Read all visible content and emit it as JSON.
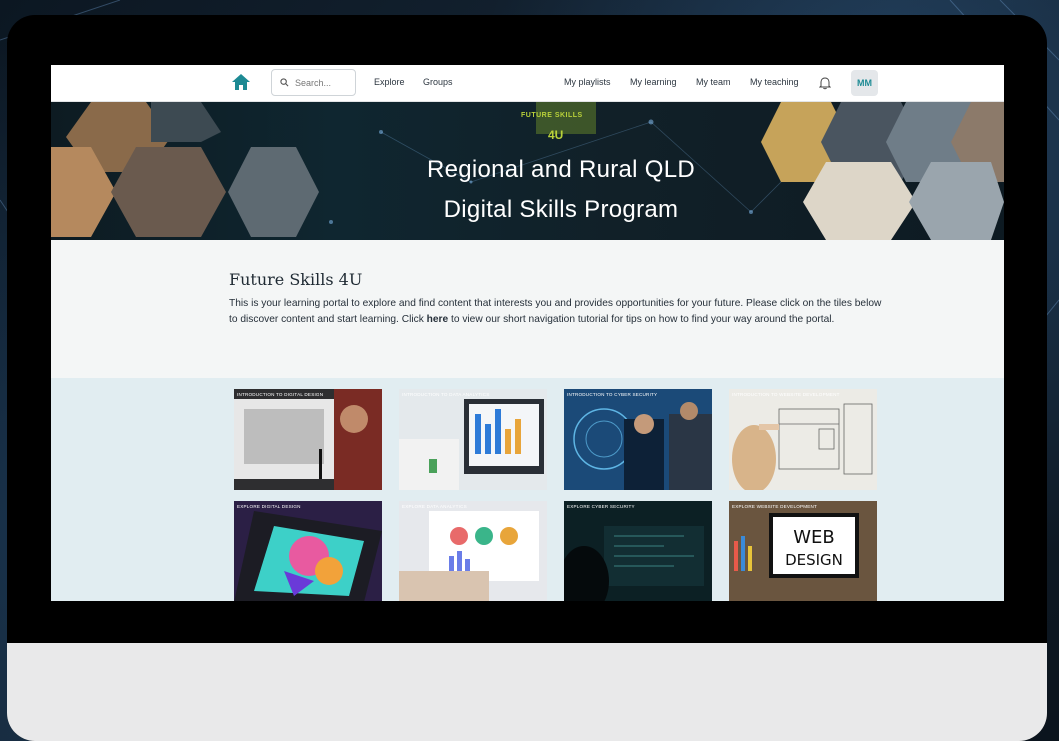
{
  "nav": {
    "search_placeholder": "Search...",
    "links_left": [
      "Explore",
      "Groups"
    ],
    "links_right": [
      "My playlists",
      "My learning",
      "My team",
      "My teaching"
    ],
    "avatar_initials": "MM",
    "accent": "#1d8a94"
  },
  "banner": {
    "title_line1": "Regional and Rural QLD",
    "title_line2": "Digital Skills Program",
    "logo_text": "FUTURE SKILLS",
    "logo_suffix": "4U"
  },
  "intro": {
    "heading": "Future Skills 4U",
    "text_before": "This is your learning portal to explore and find content that interests you and provides opportunities for your future. Please click on the tiles below to discover content and start learning. Click ",
    "link_text": "here",
    "text_after": " to view our short navigation tutorial for tips on how to find your way around the portal."
  },
  "tiles": [
    {
      "label": "INTRODUCTION TO DIGITAL DESIGN",
      "color": "#3a3a3a"
    },
    {
      "label": "INTRODUCTION TO DATA ANALYTICS",
      "color": "#dfe6ea"
    },
    {
      "label": "INTRODUCTION TO CYBER SECURITY",
      "color": "#21507a"
    },
    {
      "label": "INTRODUCTION TO WEBSITE DEVELOPMENT",
      "color": "#e9e6df"
    },
    {
      "label": "EXPLORE DIGITAL DESIGN",
      "color": "#3e2a5e"
    },
    {
      "label": "EXPLORE DATA ANALYTICS",
      "color": "#e3e6ea"
    },
    {
      "label": "EXPLORE CYBER SECURITY",
      "color": "#0d2a2c"
    },
    {
      "label": "EXPLORE WEBSITE DEVELOPMENT",
      "color": "#5a4a3a"
    }
  ]
}
